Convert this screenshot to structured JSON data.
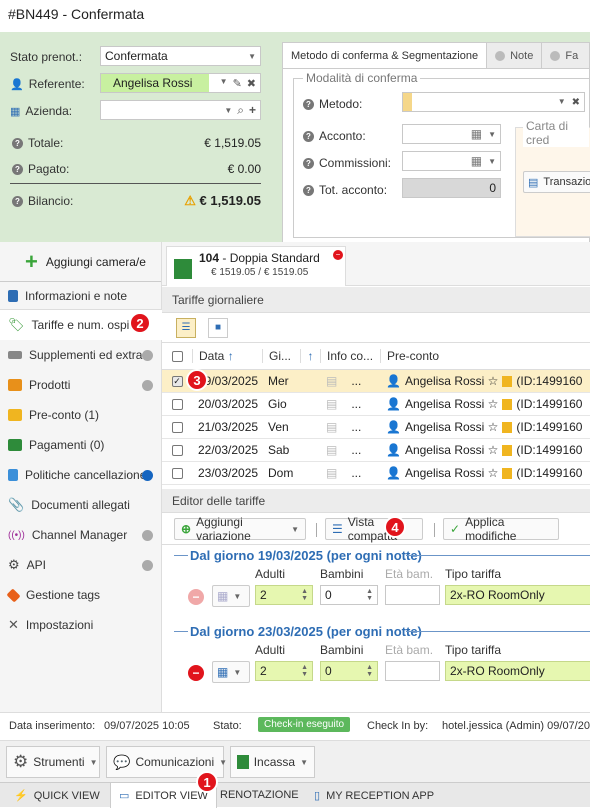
{
  "window": {
    "title": "#BN449 - Confermata"
  },
  "booking": {
    "stato_label": "Stato prenot.:",
    "stato_value": "Confermata",
    "referente_label": "Referente:",
    "referente_value": "Angelisa Rossi",
    "azienda_label": "Azienda:",
    "totale_label": "Totale:",
    "totale_value": "€ 1,519.05",
    "pagato_label": "Pagato:",
    "pagato_value": "€ 0.00",
    "bilancio_label": "Bilancio:",
    "bilancio_value": "€ 1,519.05"
  },
  "panel": {
    "tabs": [
      {
        "label": "Metodo di conferma & Segmentazione"
      },
      {
        "label": "Note"
      },
      {
        "label": "Fa"
      }
    ],
    "group_label": "Modalità di conferma",
    "metodo_label": "Metodo:",
    "acconto_label": "Acconto:",
    "commissioni_label": "Commissioni:",
    "tot_acconto_label": "Tot. acconto:",
    "tot_acconto_value": "0",
    "carta_label": "Carta di cred",
    "transazio_label": "Transazio"
  },
  "sidebar": {
    "add_room_label": "Aggiungi camera/e",
    "items": [
      {
        "label": "Informazioni e note"
      },
      {
        "label": "Tariffe e num. ospiti"
      },
      {
        "label": "Supplementi ed extra"
      },
      {
        "label": "Prodotti"
      },
      {
        "label": "Pre-conto (1)"
      },
      {
        "label": "Pagamenti (0)"
      },
      {
        "label": "Politiche cancellazione"
      },
      {
        "label": "Documenti allegati"
      },
      {
        "label": "Channel Manager"
      },
      {
        "label": "API"
      },
      {
        "label": "Gestione tags"
      },
      {
        "label": "Impostazioni"
      }
    ]
  },
  "room": {
    "number": "104",
    "name": " - Doppia Standard",
    "price": "€ 1519.05 / € 1519.05"
  },
  "tariffe": {
    "title": "Tariffe giornaliere",
    "columns": [
      "Data",
      "Gi...",
      "Info co...",
      "Pre-conto"
    ],
    "rows": [
      {
        "date": "19/03/2025",
        "day": "Mer",
        "info": "...",
        "guest": "Angelisa Rossi ☆",
        "id": "(ID:1499160"
      },
      {
        "date": "20/03/2025",
        "day": "Gio",
        "info": "...",
        "guest": "Angelisa Rossi ☆",
        "id": "(ID:1499160"
      },
      {
        "date": "21/03/2025",
        "day": "Ven",
        "info": "...",
        "guest": "Angelisa Rossi ☆",
        "id": "(ID:1499160"
      },
      {
        "date": "22/03/2025",
        "day": "Sab",
        "info": "...",
        "guest": "Angelisa Rossi ☆",
        "id": "(ID:1499160"
      },
      {
        "date": "23/03/2025",
        "day": "Dom",
        "info": "...",
        "guest": "Angelisa Rossi ☆",
        "id": "(ID:1499160"
      }
    ]
  },
  "editor": {
    "title": "Editor delle tariffe",
    "add_variation": "Aggiungi variazione",
    "vista": "Vista compatta",
    "applica": "Applica modifiche",
    "block1": {
      "heading": "Dal giorno 19/03/2025 (per ogni notte)",
      "adulti": "2",
      "bambini": "0",
      "tariffa": "2x-RO RoomOnly"
    },
    "block2": {
      "heading": "Dal giorno 23/03/2025 (per ogni notte)",
      "adulti": "2",
      "bambini": "0",
      "tariffa": "2x-RO RoomOnly"
    },
    "col_adulti": "Adulti",
    "col_bambini": "Bambini",
    "col_eta": "Età bam.",
    "col_tipo": "Tipo tariffa"
  },
  "footer": {
    "inserimento_label": "Data inserimento:",
    "inserimento_value": "09/07/2025 10:05",
    "stato_label": "Stato:",
    "stato_value": "Check-in eseguito",
    "checkin_label": "Check In by:",
    "checkin_value": "hotel.jessica (Admin) 09/07/20"
  },
  "toolbar": {
    "strumenti": "Strumenti",
    "comunicazioni": "Comunicazioni",
    "incassa": "Incassa"
  },
  "bottom": {
    "quick_view": "QUICK VIEW",
    "editor_view": "EDITOR VIEW",
    "prenotazione": "RENOTAZIONE",
    "app": "MY RECEPTION APP"
  },
  "badges": {
    "b1": "1",
    "b2": "2",
    "b3": "3",
    "b4": "4"
  },
  "colors": {
    "accent": "#2e6db4",
    "badge": "#e1141c",
    "top_bg": "#d9ead3",
    "green": "#5cb85c"
  }
}
